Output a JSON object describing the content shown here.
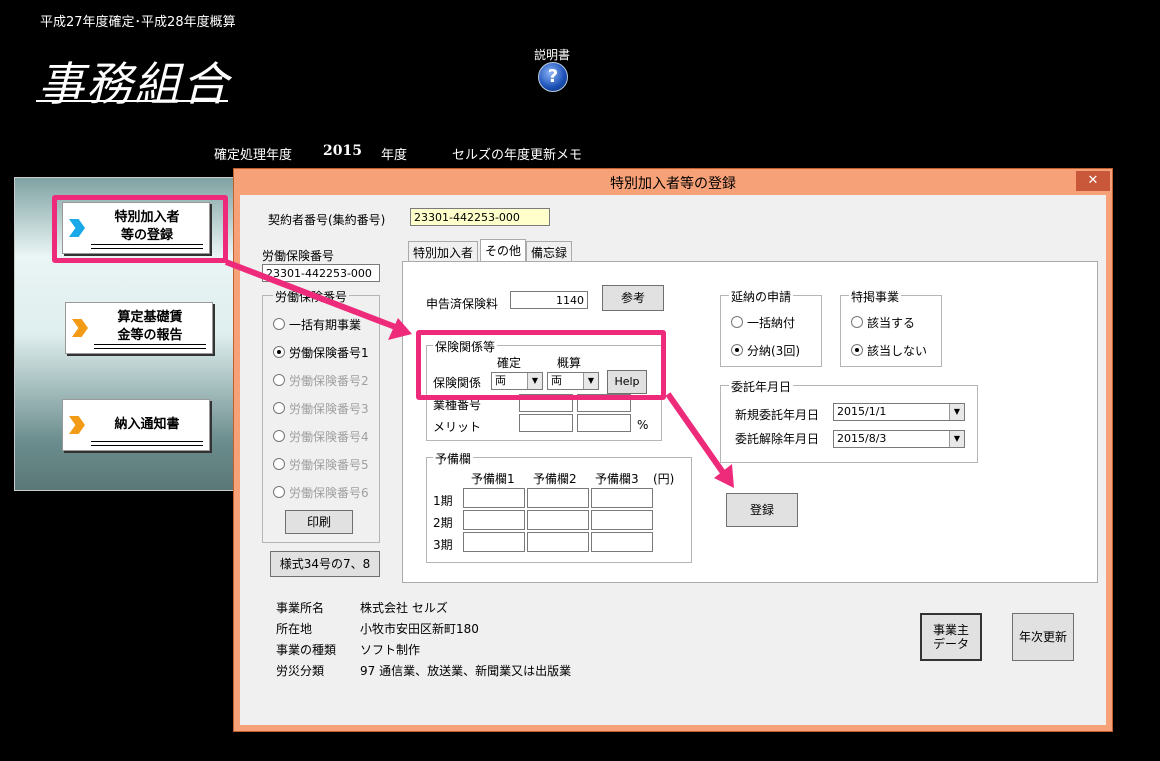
{
  "header": {
    "subtitle": "平成27年度確定･平成28年度概算",
    "app_title": "事務組合",
    "manual_label": "説明書",
    "help_glyph": "?",
    "year_label": "確定処理年度",
    "year_value": "2015",
    "year_suffix": "年度",
    "memo_link": "セルズの年度更新メモ"
  },
  "menu": {
    "item1": "特別加入者\n等の登録",
    "item1_l1": "特別加入者",
    "item1_l2": "等の登録",
    "item2_l1": "算定基礎賃",
    "item2_l2": "金等の報告",
    "item3": "納入通知書"
  },
  "dialog": {
    "title": "特別加入者等の登録",
    "close": "✕",
    "contract_label": "契約者番号(集約番号)",
    "contract_value": "23301-442253-000",
    "labor_ins_label": "労働保険番号",
    "labor_ins_value": "23301-442253-000",
    "labor_group_title": "労働保険番号",
    "labor_options": [
      "一括有期事業",
      "労働保険番号1",
      "労働保険番号2",
      "労働保険番号3",
      "労働保険番号4",
      "労働保険番号5",
      "労働保険番号6"
    ],
    "print_button": "印刷",
    "form_button": "様式34号の7、8",
    "tabs": [
      "特別加入者",
      "その他",
      "備忘録"
    ],
    "declared_label": "申告済保険料",
    "declared_value": "1140",
    "ref_button": "参考",
    "ins_rel_group": "保険関係等",
    "col_confirmed": "確定",
    "col_estimate": "概算",
    "ins_rel_label": "保険関係",
    "ins_rel_confirmed": "両",
    "ins_rel_estimate": "両",
    "help_button": "Help",
    "industry_label": "業種番号",
    "merit_label": "メリット",
    "percent": "%",
    "reserve_group": "予備欄",
    "reserve_headers": [
      "予備欄1",
      "予備欄2",
      "予備欄3",
      "(円)"
    ],
    "reserve_rows": [
      "1期",
      "2期",
      "3期"
    ],
    "deferral_group": "延納の申請",
    "deferral_opts": [
      "一括納付",
      "分納(3回)"
    ],
    "special_group": "特掲事業",
    "special_opts": [
      "該当する",
      "該当しない"
    ],
    "consign_group": "委託年月日",
    "new_consign_label": "新規委託年月日",
    "new_consign_value": "2015/1/1",
    "cancel_consign_label": "委託解除年月日",
    "cancel_consign_value": "2015/8/3",
    "register_button": "登録",
    "biz_name_label": "事業所名",
    "biz_name_value": "株式会社 セルズ",
    "address_label": "所在地",
    "address_value": "小牧市安田区新町180",
    "biz_type_label": "事業の種類",
    "biz_type_value": "ソフト制作",
    "accident_label": "労災分類",
    "accident_value": "97 通信業、放送業、新聞業又は出版業",
    "owner_data_button_l1": "事業主",
    "owner_data_button_l2": "データ",
    "annual_update_button": "年次更新"
  },
  "colors": {
    "highlight": "#ee2a7b",
    "dialog_frame": "#f6a177"
  }
}
